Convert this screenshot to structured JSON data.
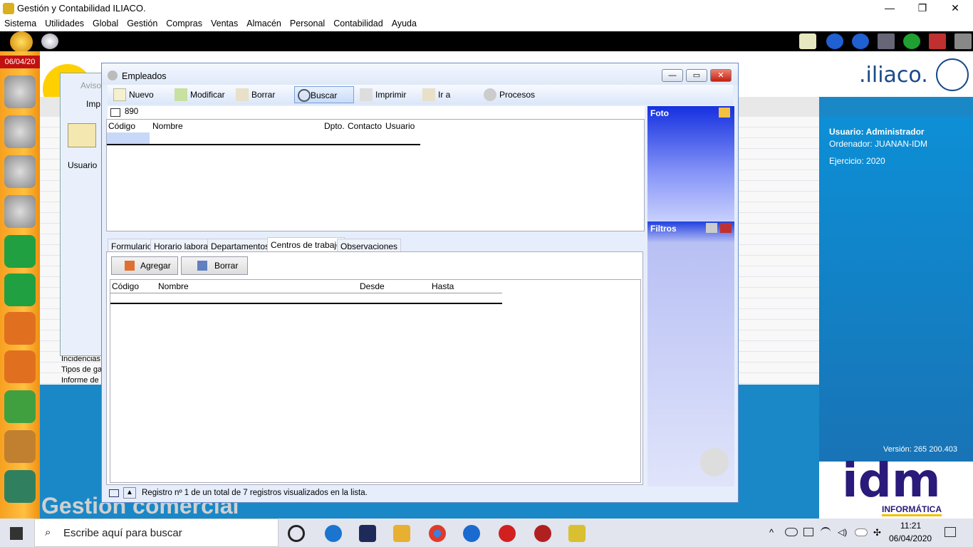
{
  "window": {
    "title": "Gestión y Contabilidad ILIACO."
  },
  "menu": [
    "Sistema",
    "Utilidades",
    "Global",
    "Gestión",
    "Compras",
    "Ventas",
    "Almacén",
    "Personal",
    "Contabilidad",
    "Ayuda"
  ],
  "rail": {
    "date": "06/04/20"
  },
  "background": {
    "logo_text": ".iliaco.",
    "commercial_text": "Gestion comercial",
    "row1": "Incidencias",
    "row2": "Tipos de ga",
    "row3": "Informe de"
  },
  "backwin": {
    "title": "Aviso",
    "btn": "Imp",
    "col": "Usuario"
  },
  "empleados": {
    "title": "Empleados",
    "toolbar": {
      "nuevo": "Nuevo",
      "modificar": "Modificar",
      "borrar": "Borrar",
      "buscar": "Buscar",
      "imprimir": "Imprimir",
      "ira": "Ir a",
      "procesos": "Procesos"
    },
    "search_value": "890",
    "grid_cols": [
      "Código",
      "Nombre",
      "Dpto.",
      "Contacto",
      "Usuario"
    ],
    "tabs": [
      "Formulario",
      "Horario laboral",
      "Departamentos",
      "Centros de trabajo",
      "Observaciones"
    ],
    "agregar": "Agregar",
    "borrar2": "Borrar",
    "grid2_cols": [
      "Código",
      "Nombre",
      "Desde",
      "Hasta"
    ],
    "status": "Registro nº 1 de un total de 7 registros visualizados en la lista."
  },
  "panels": {
    "foto": "Foto",
    "filtros": "Filtros"
  },
  "right": {
    "usuario": "Usuario: Administrador",
    "ordenador": "Ordenador: JUANAN-IDM",
    "ejercicio": "Ejercicio: 2020",
    "version": "Versión: 265 200.403",
    "brand_big": "idm",
    "brand_small": "INFORMÁTICA"
  },
  "taskbar": {
    "search_placeholder": "Escribe aquí para buscar",
    "time": "11:21",
    "date": "06/04/2020"
  },
  "colors": {
    "accent": "#1a88c7",
    "rail": "#f7a020",
    "date_bg": "#c01010",
    "brand": "#2a1a7a"
  }
}
